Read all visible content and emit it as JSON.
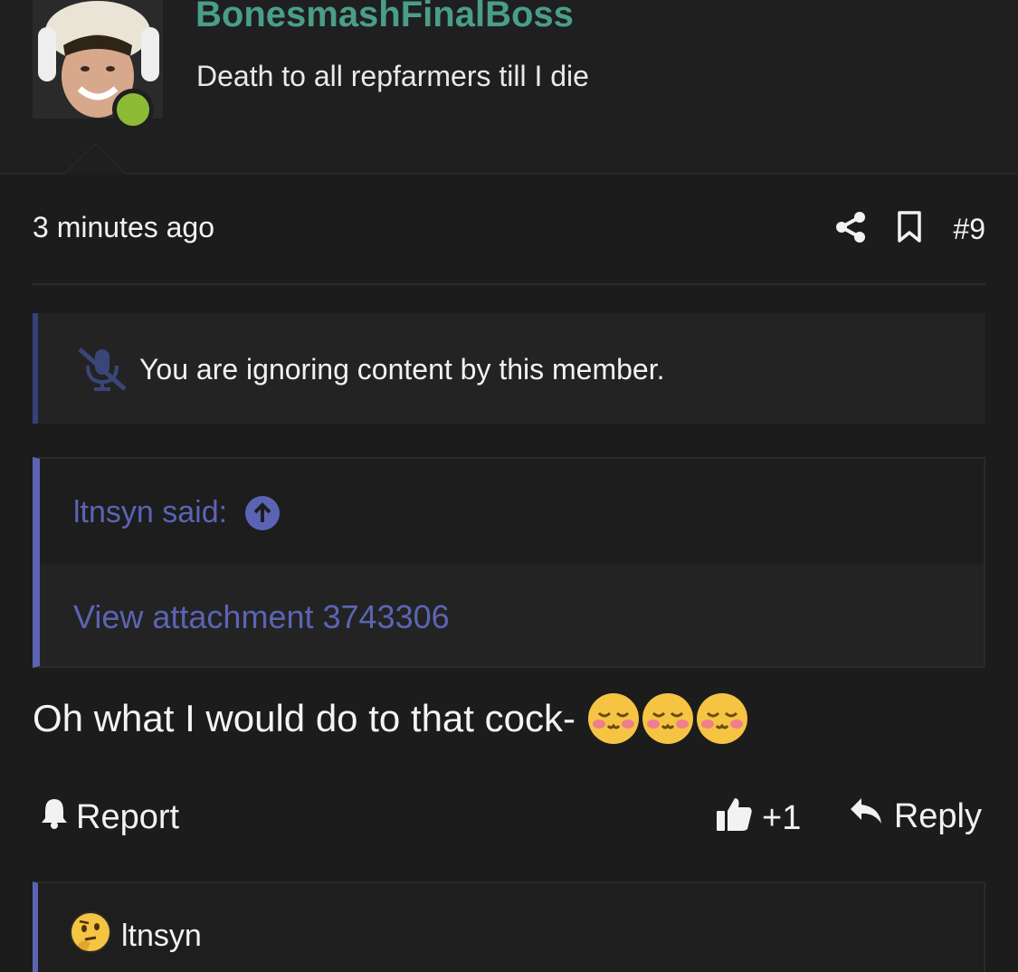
{
  "post": {
    "username": "BonesmashFinalBoss",
    "user_title": "Death to all repfarmers till I die",
    "timestamp": "3 minutes ago",
    "post_number": "#9",
    "ignore_notice": "You are ignoring content by this member.",
    "quote": {
      "author": "ltnsyn said:",
      "attachment": "View attachment 3743306"
    },
    "message": "Oh what I would do to that cock-",
    "actions": {
      "report": "Report",
      "like_count": "+1",
      "reply": "Reply"
    }
  },
  "next_post": {
    "username": "ltnsyn"
  },
  "icons": {
    "share": "share-icon",
    "bookmark": "bookmark-icon",
    "mute": "mute-icon",
    "up_arrow": "arrow-up-circle-icon",
    "emoji": "blushing-face-emoji",
    "bell": "bell-icon",
    "thumbs_up": "thumbs-up-icon",
    "reply": "reply-arrow-icon",
    "thinking": "thinking-face-emoji"
  },
  "colors": {
    "background": "#1c1c1c",
    "username": "#4a9e89",
    "quote_accent": "#5b64b4",
    "online": "#8dbb36"
  }
}
